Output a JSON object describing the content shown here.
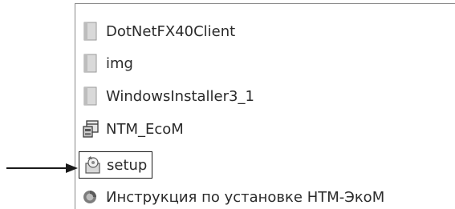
{
  "file_list": {
    "items": [
      {
        "label": "DotNetFX40Client",
        "icon": "folder-icon"
      },
      {
        "label": "img",
        "icon": "folder-icon"
      },
      {
        "label": "WindowsInstaller3_1",
        "icon": "folder-icon"
      },
      {
        "label": "NTM_EcoM",
        "icon": "application-icon"
      },
      {
        "label": "setup",
        "icon": "setup-icon"
      },
      {
        "label": "Инструкция по установке НТМ-ЭкоМ",
        "icon": "document-icon"
      }
    ]
  },
  "annotation": {
    "pointer": "arrow-pointer-icon",
    "highlighted_item": "setup"
  },
  "colors": {
    "text": "#2b2b2b",
    "folder": "#d4d4d4",
    "folder_dark": "#a8a8a8",
    "highlight_border": "#1a1a1a"
  }
}
